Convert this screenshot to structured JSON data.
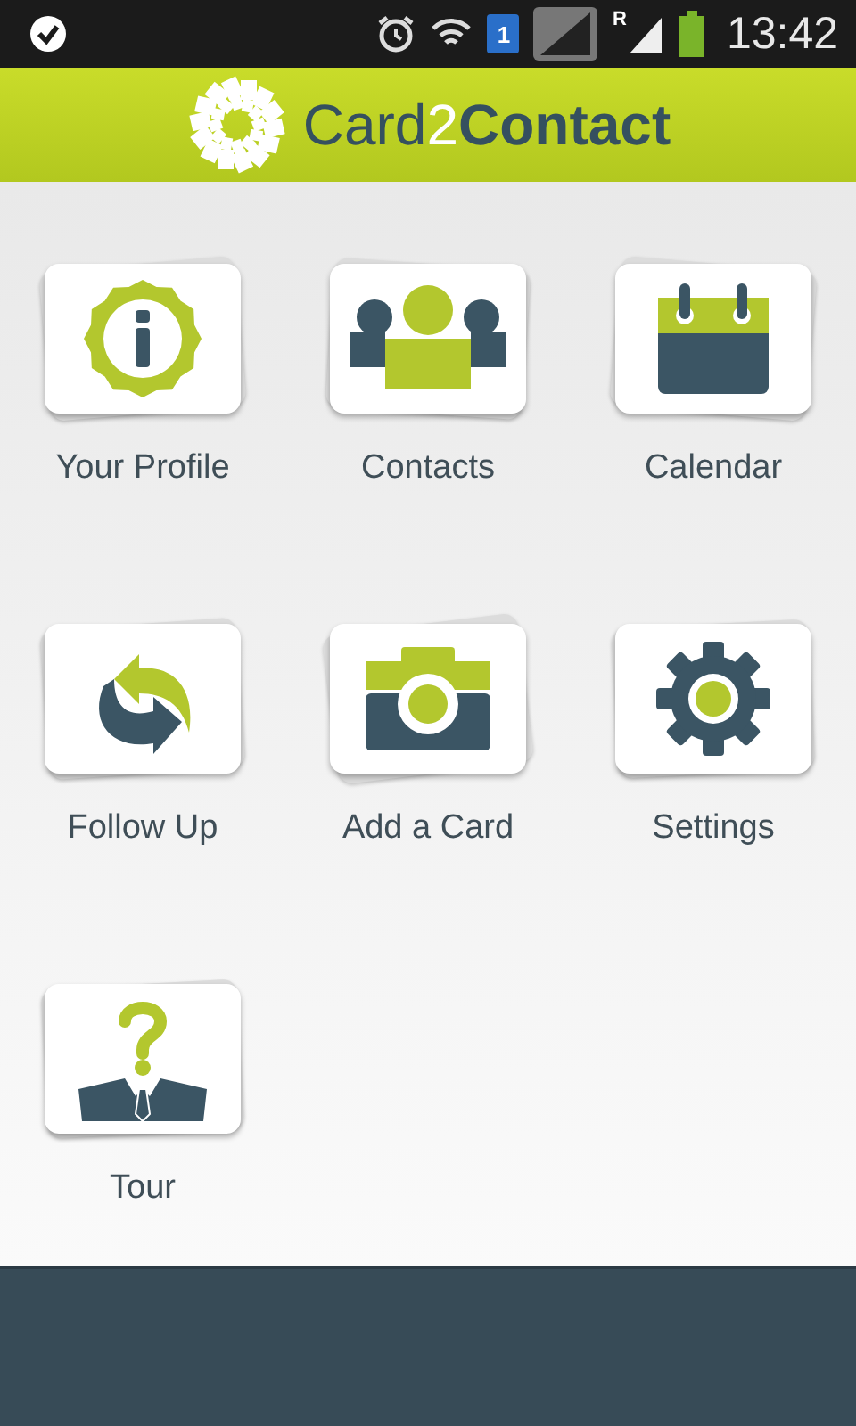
{
  "status_bar": {
    "sim_slot": "1",
    "roaming": "R",
    "time": "13:42"
  },
  "header": {
    "logo_parts": [
      "Card",
      "2",
      "Contact"
    ]
  },
  "menu": [
    {
      "kind": "profile",
      "label": "Your Profile"
    },
    {
      "kind": "contacts",
      "label": "Contacts"
    },
    {
      "kind": "calendar",
      "label": "Calendar"
    },
    {
      "kind": "followup",
      "label": "Follow Up"
    },
    {
      "kind": "camera",
      "label": "Add a Card"
    },
    {
      "kind": "settings",
      "label": "Settings"
    },
    {
      "kind": "tour",
      "label": "Tour"
    }
  ]
}
